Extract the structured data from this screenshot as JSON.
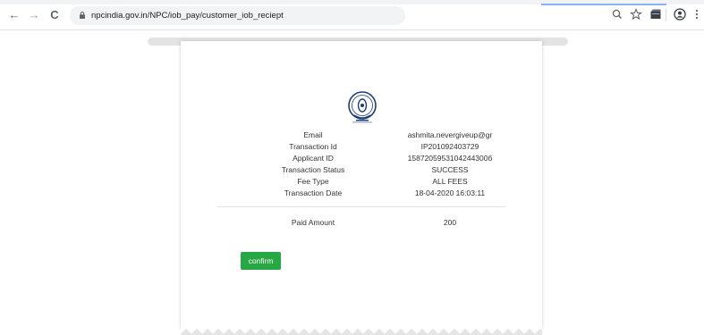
{
  "browser": {
    "url": "npcindia.gov.in/NPC/iob_pay/customer_iob_reciept",
    "back_glyph": "←",
    "forward_glyph": "→",
    "reload_glyph": "C"
  },
  "receipt": {
    "fields": [
      {
        "label": "Email",
        "value": "ashmita.nevergiveup@gr"
      },
      {
        "label": "Transaction Id",
        "value": "IP201092403729"
      },
      {
        "label": "Applicant ID",
        "value": "1587205953104244300б"
      },
      {
        "label": "Transaction Status",
        "value": "SUCCESS"
      },
      {
        "label": "Fee Type",
        "value": "ALL FEES"
      },
      {
        "label": "Transaction Date",
        "value": "18-04-2020 16:03:11"
      }
    ],
    "paid_amount_label": "Paid Amount",
    "paid_amount_value": "200",
    "confirm_label": "confirm"
  },
  "colors": {
    "confirm_bg": "#28a745",
    "logo_blue": "#1f3d7a"
  },
  "icons": [
    "back-arrow-icon",
    "forward-arrow-icon",
    "reload-icon",
    "lock-icon",
    "zoom-icon",
    "star-icon",
    "extension-icon",
    "account-icon",
    "menu-icon",
    "organization-logo-icon"
  ]
}
